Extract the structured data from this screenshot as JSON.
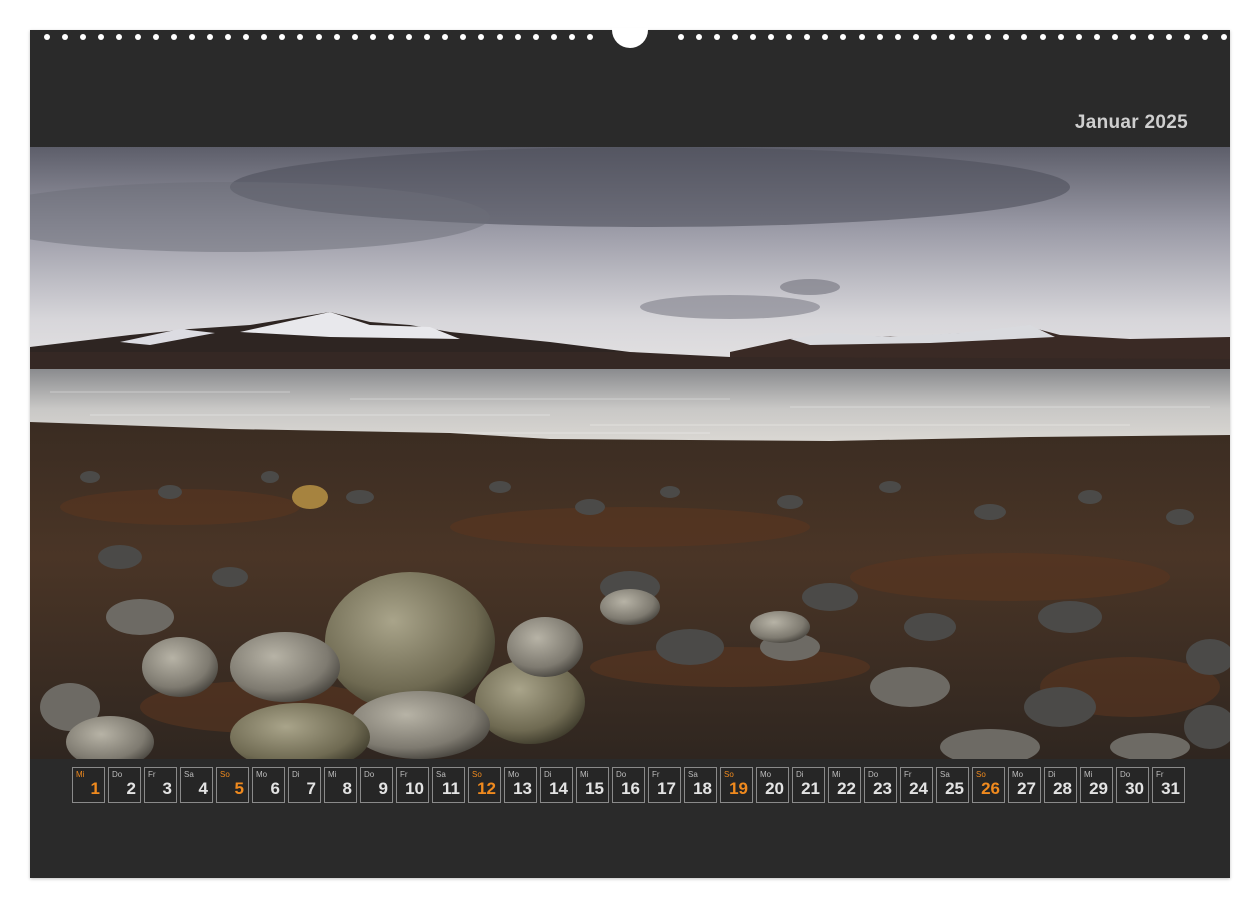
{
  "calendar": {
    "month_title": "Januar 2025",
    "days": [
      {
        "wd": "Mi",
        "d": "1",
        "hl": true
      },
      {
        "wd": "Do",
        "d": "2"
      },
      {
        "wd": "Fr",
        "d": "3"
      },
      {
        "wd": "Sa",
        "d": "4"
      },
      {
        "wd": "So",
        "d": "5",
        "hl": true
      },
      {
        "wd": "Mo",
        "d": "6"
      },
      {
        "wd": "Di",
        "d": "7"
      },
      {
        "wd": "Mi",
        "d": "8"
      },
      {
        "wd": "Do",
        "d": "9"
      },
      {
        "wd": "Fr",
        "d": "10"
      },
      {
        "wd": "Sa",
        "d": "11"
      },
      {
        "wd": "So",
        "d": "12",
        "hl": true
      },
      {
        "wd": "Mo",
        "d": "13"
      },
      {
        "wd": "Di",
        "d": "14"
      },
      {
        "wd": "Mi",
        "d": "15"
      },
      {
        "wd": "Do",
        "d": "16"
      },
      {
        "wd": "Fr",
        "d": "17"
      },
      {
        "wd": "Sa",
        "d": "18"
      },
      {
        "wd": "So",
        "d": "19",
        "hl": true
      },
      {
        "wd": "Mo",
        "d": "20"
      },
      {
        "wd": "Di",
        "d": "21"
      },
      {
        "wd": "Mi",
        "d": "22"
      },
      {
        "wd": "Do",
        "d": "23"
      },
      {
        "wd": "Fr",
        "d": "24"
      },
      {
        "wd": "Sa",
        "d": "25"
      },
      {
        "wd": "So",
        "d": "26",
        "hl": true
      },
      {
        "wd": "Mo",
        "d": "27"
      },
      {
        "wd": "Di",
        "d": "28"
      },
      {
        "wd": "Mi",
        "d": "29"
      },
      {
        "wd": "Do",
        "d": "30"
      },
      {
        "wd": "Fr",
        "d": "31"
      }
    ]
  },
  "colors": {
    "page_bg": "#2a2a2a",
    "highlight": "#f08a1e",
    "text": "#e3e3e3"
  }
}
